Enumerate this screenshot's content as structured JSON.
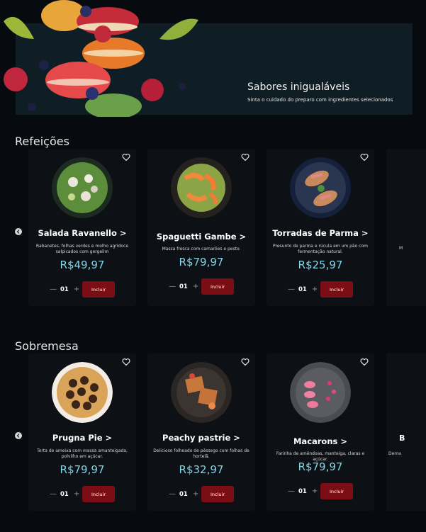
{
  "hero": {
    "title": "Sabores inigualáveis",
    "subtitle": "Sinta o cuidado do preparo com ingredientes selecionados"
  },
  "sections": [
    {
      "title": "Refeições",
      "cards": [
        {
          "name": "Salada Ravanello >",
          "desc": "Rabanetes, folhas verdes e molho agridoce salpicados com gergelim",
          "price": "R$49,97",
          "qty": "01",
          "button": "Incluir"
        },
        {
          "name": "Spaguetti Gambe >",
          "desc": "Massa fresca com camarões e pesto.",
          "price": "R$79,97",
          "qty": "01",
          "button": "Incluir"
        },
        {
          "name": "Torradas de Parma >",
          "desc": "Presunto de parma e rúcula em um pão com fermentação natural.",
          "price": "R$25,97",
          "qty": "01",
          "button": "Incluir"
        }
      ],
      "peek_text": "M"
    },
    {
      "title": "Sobremesa",
      "cards": [
        {
          "name": "Prugna Pie >",
          "desc": "Torta de ameixa com massa amanteigada, polvilho em açúcar.",
          "price": "R$79,97",
          "qty": "01",
          "button": "Incluir"
        },
        {
          "name": "Peachy pastrie >",
          "desc": "Delicioso folheado de pêssego com folhas de hortelã.",
          "price": "R$32,97",
          "qty": "01",
          "button": "Incluir"
        },
        {
          "name": "Macarons >",
          "desc": "Farinha de amêndoas, manteiga, claras e açúcar.",
          "price": "R$79,97",
          "qty": "01",
          "button": "Incluir"
        }
      ],
      "peek_name": "B",
      "peek_text": "Dema"
    }
  ],
  "controls": {
    "minus": "—",
    "plus": "+"
  }
}
